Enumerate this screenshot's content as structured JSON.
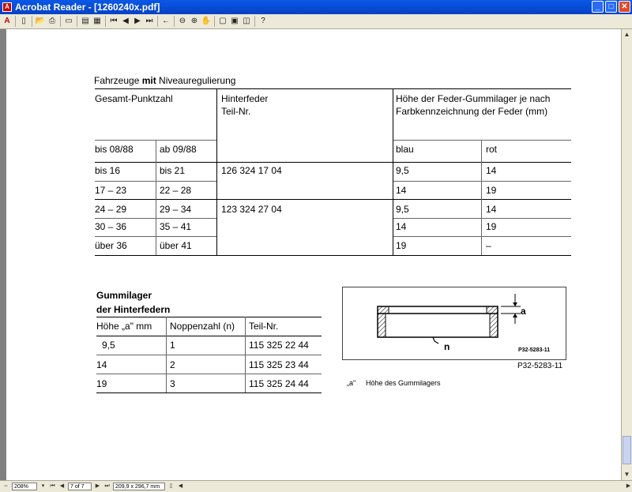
{
  "window": {
    "title": "Acrobat Reader - [1260240x.pdf]",
    "min_glyph": "_",
    "max_glyph": "□",
    "close_glyph": "✕"
  },
  "toolbar": {
    "help_label": "?"
  },
  "document": {
    "table1": {
      "heading_prefix": "Fahrzeuge ",
      "heading_bold": "mit",
      "heading_suffix": " Niveauregulierung",
      "col_points": "Gesamt-Punktzahl",
      "col_spring_line1": "Hinterfeder",
      "col_spring_line2": "Teil-Nr.",
      "col_height_line1": "Höhe der Feder-Gummilager je nach",
      "col_height_line2": "Farbkennzeichnung der Feder (mm)",
      "sub_until": "bis 08/88",
      "sub_from": "ab 09/88",
      "sub_blue": "blau",
      "sub_red": "rot",
      "rows": [
        [
          "bis 16",
          "bis 21",
          "126 324 17 04",
          "9,5",
          "14"
        ],
        [
          "17 – 23",
          "22 – 28",
          "",
          "14",
          "19"
        ],
        [
          "24 – 29",
          "29 – 34",
          "123 324 27 04",
          "9,5",
          "14"
        ],
        [
          "30 – 36",
          "35 – 41",
          "",
          "14",
          "19"
        ],
        [
          "über 36",
          "über 41",
          "",
          "19",
          "–"
        ]
      ]
    },
    "table2": {
      "heading_line1": "Gummilager",
      "heading_line2": "der Hinterfedern",
      "col_height": "Höhe „a\" mm",
      "col_knobs": "Noppenzahl (n)",
      "col_part": "Teil-Nr.",
      "rows": [
        [
          "9,5",
          "1",
          "115 325 22 44"
        ],
        [
          "14",
          "2",
          "115 325 23 44"
        ],
        [
          "19",
          "3",
          "115 325 24 44"
        ]
      ]
    },
    "figure": {
      "label_a": "a",
      "label_n": "n",
      "inner_code": "P32-5283-11",
      "caption_code": "P32-5283-11",
      "legend_key": "„a\"",
      "legend_text": "Höhe des Gummilagers"
    }
  },
  "statusbar": {
    "zoom": "208%",
    "page": "7 of 7",
    "page_size": "209,9 x 296,7 mm"
  }
}
